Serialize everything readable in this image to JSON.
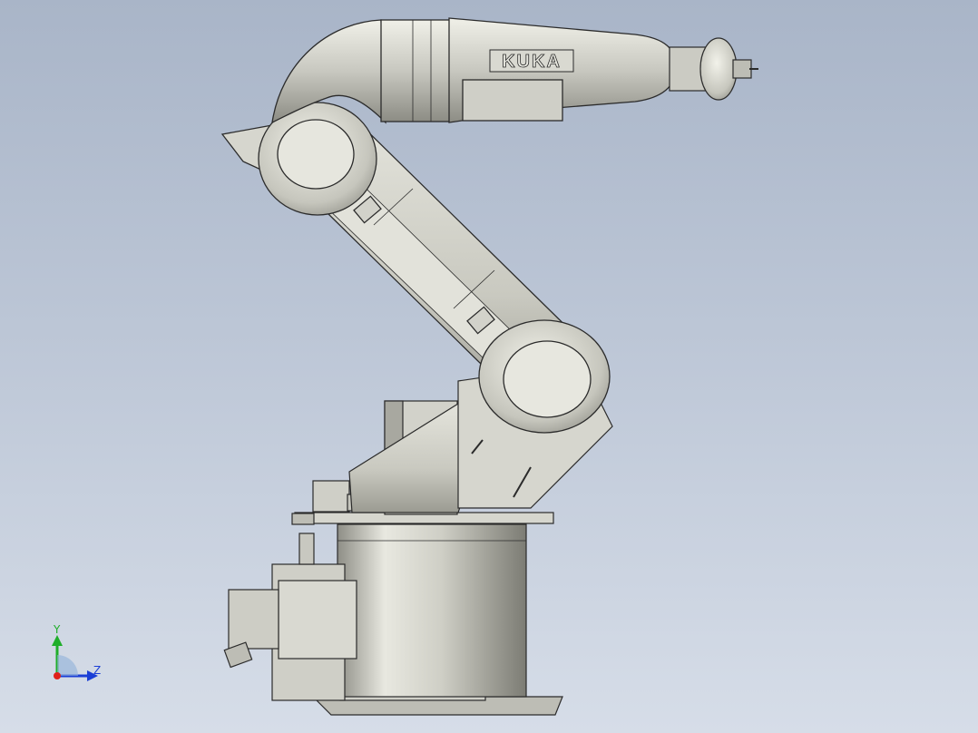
{
  "viewport": {
    "background_top": "#a9b5c8",
    "background_bottom": "#d6dde8"
  },
  "model": {
    "brand_label": "KUKA",
    "body_color": "#d8d8d0",
    "edge_color": "#2b2b2b"
  },
  "triad": {
    "y_label": "Y",
    "z_label": "Z",
    "x_color": "#e0201a",
    "y_color": "#1fae2a",
    "z_color": "#1b3fd6"
  }
}
